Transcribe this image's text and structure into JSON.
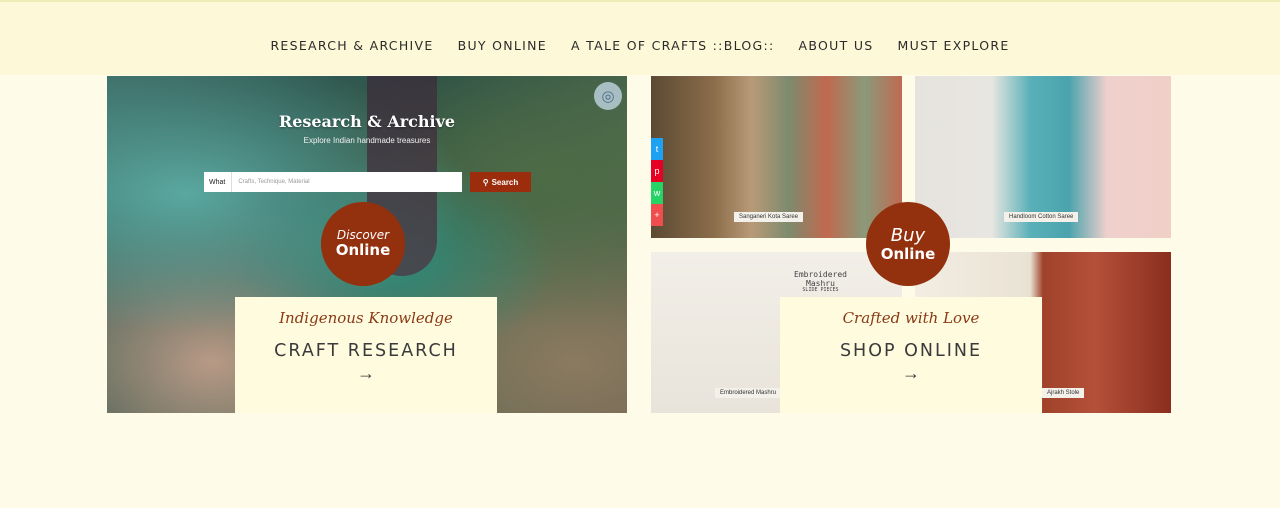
{
  "nav": {
    "items": [
      "RESEARCH & ARCHIVE",
      "BUY ONLINE",
      "A TALE OF CRAFTS ::BLOG::",
      "ABOUT US",
      "MUST EXPLORE"
    ]
  },
  "left": {
    "banner_title": "Research & Archive",
    "banner_subtitle": "Explore Indian handmade treasures",
    "search_label": "What",
    "search_placeholder": "Crafts, Technique, Material",
    "search_button": "Search",
    "circle_line1": "Discover",
    "circle_line2": "Online",
    "card_script": "Indigenous Knowledge",
    "card_title": "CRAFT RESEARCH",
    "card_arrow": "→"
  },
  "right": {
    "tile_labels": [
      "Sanganeri Kota Saree",
      "Handloom Cotton Saree",
      "Embroidered Mashru",
      "Ajrakh Stole"
    ],
    "emb_text_line1": "Embroidered",
    "emb_text_line2": "Mashru",
    "emb_text_line3": "SLIDE PIECES",
    "circle_line1": "Buy",
    "circle_line2": "Online",
    "card_script": "Crafted with Love",
    "card_title": "SHOP ONLINE",
    "card_arrow": "→"
  },
  "colors": {
    "accent": "#93300e",
    "nav_bg": "#fdf9d8",
    "page_bg": "#fefce8",
    "card_bg": "#fefbdf"
  },
  "icons": [
    "visual-search-icon",
    "search-icon",
    "twitter-icon",
    "facebook-icon",
    "pinterest-icon",
    "whatsapp-icon",
    "more-share-icon"
  ]
}
